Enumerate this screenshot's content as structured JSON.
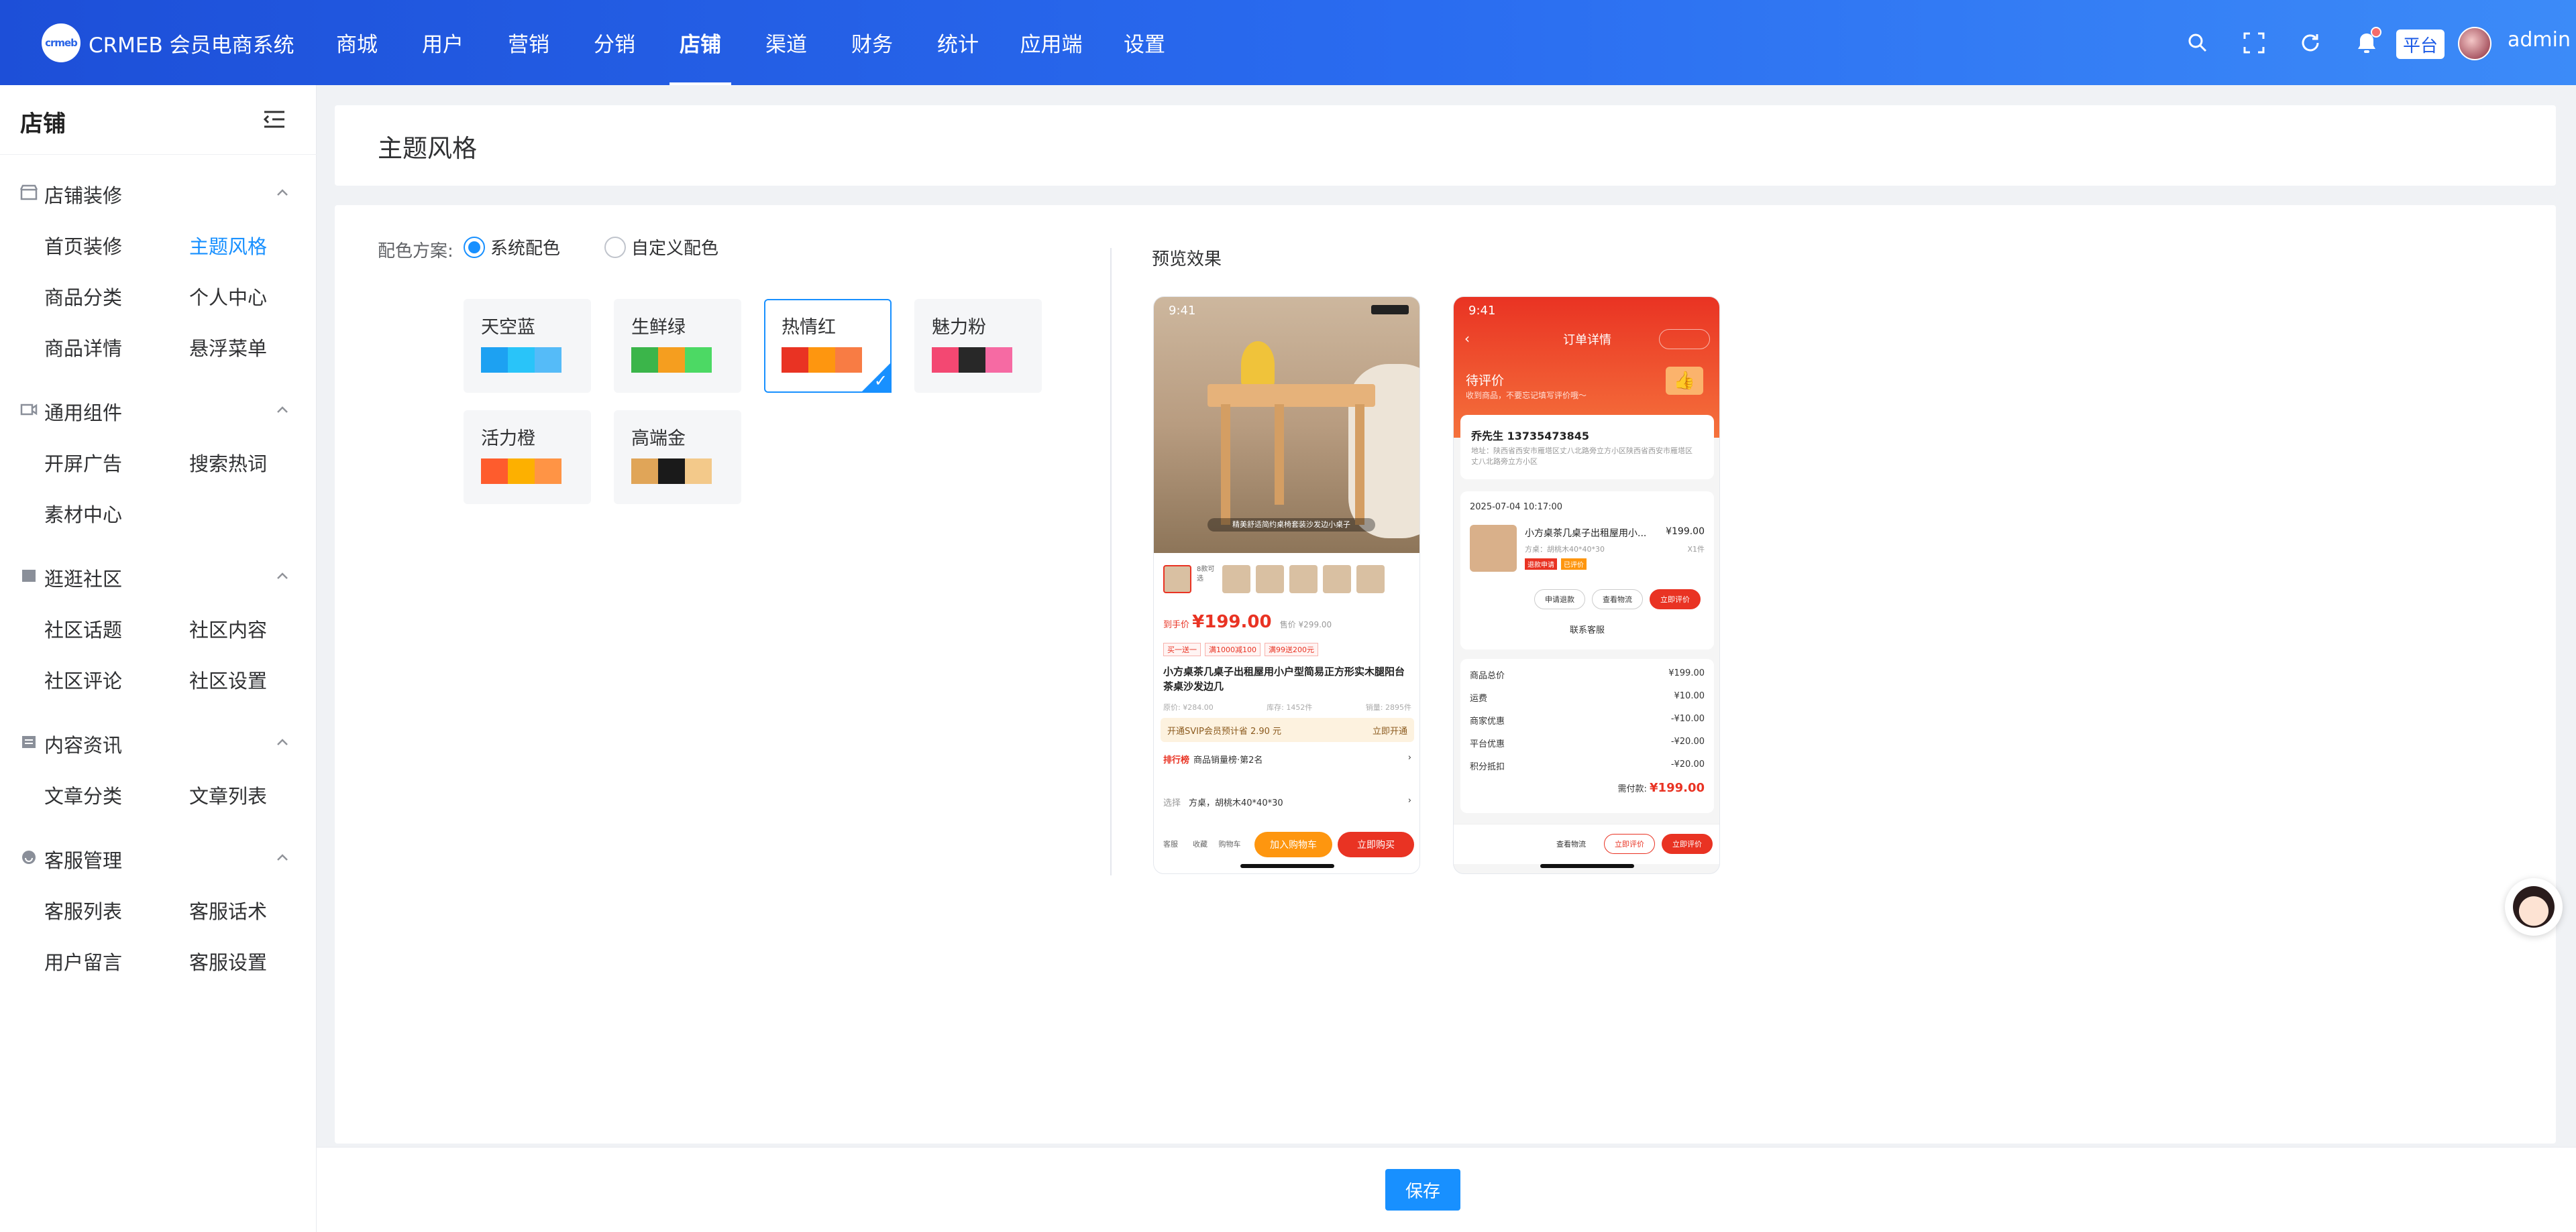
{
  "header": {
    "logo_text": "crmeb",
    "brand": "CRMEB 会员电商系统",
    "nav": [
      {
        "label": "商城"
      },
      {
        "label": "用户"
      },
      {
        "label": "营销"
      },
      {
        "label": "分销"
      },
      {
        "label": "店铺",
        "active": true
      },
      {
        "label": "渠道"
      },
      {
        "label": "财务"
      },
      {
        "label": "统计"
      },
      {
        "label": "应用端"
      },
      {
        "label": "设置"
      }
    ],
    "tools": [
      "search-icon",
      "fullscreen-icon",
      "refresh-icon",
      "bell-icon"
    ],
    "platform_label": "平台",
    "user": "admin"
  },
  "sidebar": {
    "title": "店铺",
    "groups": [
      {
        "label": "店铺装修",
        "icon": "shop-icon",
        "items": [
          "首页装修",
          "主题风格",
          "商品分类",
          "个人中心",
          "商品详情",
          "悬浮菜单"
        ]
      },
      {
        "label": "通用组件",
        "icon": "component-icon",
        "items": [
          "开屏广告",
          "搜索热词",
          "素材中心"
        ]
      },
      {
        "label": "逛逛社区",
        "icon": "community-icon",
        "items": [
          "社区话题",
          "社区内容",
          "社区评论",
          "社区设置"
        ]
      },
      {
        "label": "内容资讯",
        "icon": "article-icon",
        "items": [
          "文章分类",
          "文章列表"
        ]
      },
      {
        "label": "客服管理",
        "icon": "service-icon",
        "items": [
          "客服列表",
          "客服话术",
          "用户留言",
          "客服设置"
        ]
      }
    ],
    "active_item": "主题风格"
  },
  "page": {
    "title": "主题风格",
    "scheme_label": "配色方案:",
    "scheme_options": [
      "系统配色",
      "自定义配色"
    ],
    "scheme_selected": "系统配色",
    "preview_label": "预览效果",
    "save_label": "保存"
  },
  "themes": [
    {
      "name": "天空蓝",
      "colors": [
        "#1da1f2",
        "#29c4f9",
        "#55bbf8"
      ]
    },
    {
      "name": "生鲜绿",
      "colors": [
        "#3bb54a",
        "#f59e1f",
        "#4cd964"
      ]
    },
    {
      "name": "热情红",
      "colors": [
        "#e93323",
        "#fe960f",
        "#f87c44"
      ],
      "selected": true
    },
    {
      "name": "魅力粉",
      "colors": [
        "#f34872",
        "#282828",
        "#f66aa3"
      ]
    },
    {
      "name": "活力橙",
      "colors": [
        "#fe5c2d",
        "#fdb000",
        "#ff9445"
      ]
    },
    {
      "name": "高端金",
      "colors": [
        "#e0a558",
        "#1a1a1a",
        "#f3c98a"
      ]
    }
  ],
  "preview_product": {
    "time": "9:41",
    "photo_caption": "精美舒适简约桌椅套装沙发边小桌子",
    "thumb_count_label": "8款可选",
    "price_prefix": "到手价",
    "price": "¥199.00",
    "original_price": "售价 ¥299.00",
    "tags": [
      "买一送一",
      "满1000减100",
      "满99送200元"
    ],
    "title": "小方桌茶几桌子出租屋用小户型简易正方形实木腿阳台茶桌沙发边几",
    "meta": [
      "原价: ¥284.00",
      "库存: 1452件",
      "销量: 2895件"
    ],
    "svip_text": "开通SVIP会员预计省 2.90 元",
    "svip_action": "立即开通",
    "rank_label": "排行榜",
    "rank_text": "商品销量榜·第2名",
    "select_key": "选择",
    "select_value": "方桌，胡桃木40*40*30",
    "bottom_icons": [
      "客服",
      "收藏",
      "购物车"
    ],
    "cart_btn": "加入购物车",
    "buy_btn": "立即购买"
  },
  "preview_order": {
    "time": "9:41",
    "title": "订单详情",
    "state": "待评价",
    "state_sub": "收到商品，不要忘记填写评价哦～",
    "name_phone": "乔先生 13735473845",
    "address": "地址：陕西省西安市雁塔区丈八北路旁立方小区陕西省西安市雁塔区丈八北路旁立方小区",
    "order_time": "2025-07-04 10:17:00",
    "item_name": "小方桌茶几桌子出租屋用小...",
    "item_price": "¥199.00",
    "item_spec": "方桌：胡桃木40*40*30",
    "item_qty": "X1件",
    "item_tags": [
      "退款申请",
      "已评价"
    ],
    "item_actions": [
      "申请退款",
      "查看物流",
      "立即评价"
    ],
    "contact": "联系客服",
    "summary": [
      {
        "k": "商品总价",
        "v": "¥199.00"
      },
      {
        "k": "运费",
        "v": "¥10.00"
      },
      {
        "k": "商家优惠",
        "v": "-¥10.00"
      },
      {
        "k": "平台优惠",
        "v": "-¥20.00"
      },
      {
        "k": "积分抵扣",
        "v": "-¥20.00"
      }
    ],
    "paid_label": "需付款:",
    "paid_value": "¥199.00",
    "footer_actions": [
      "查看物流",
      "立即评价",
      "立即评价"
    ]
  }
}
